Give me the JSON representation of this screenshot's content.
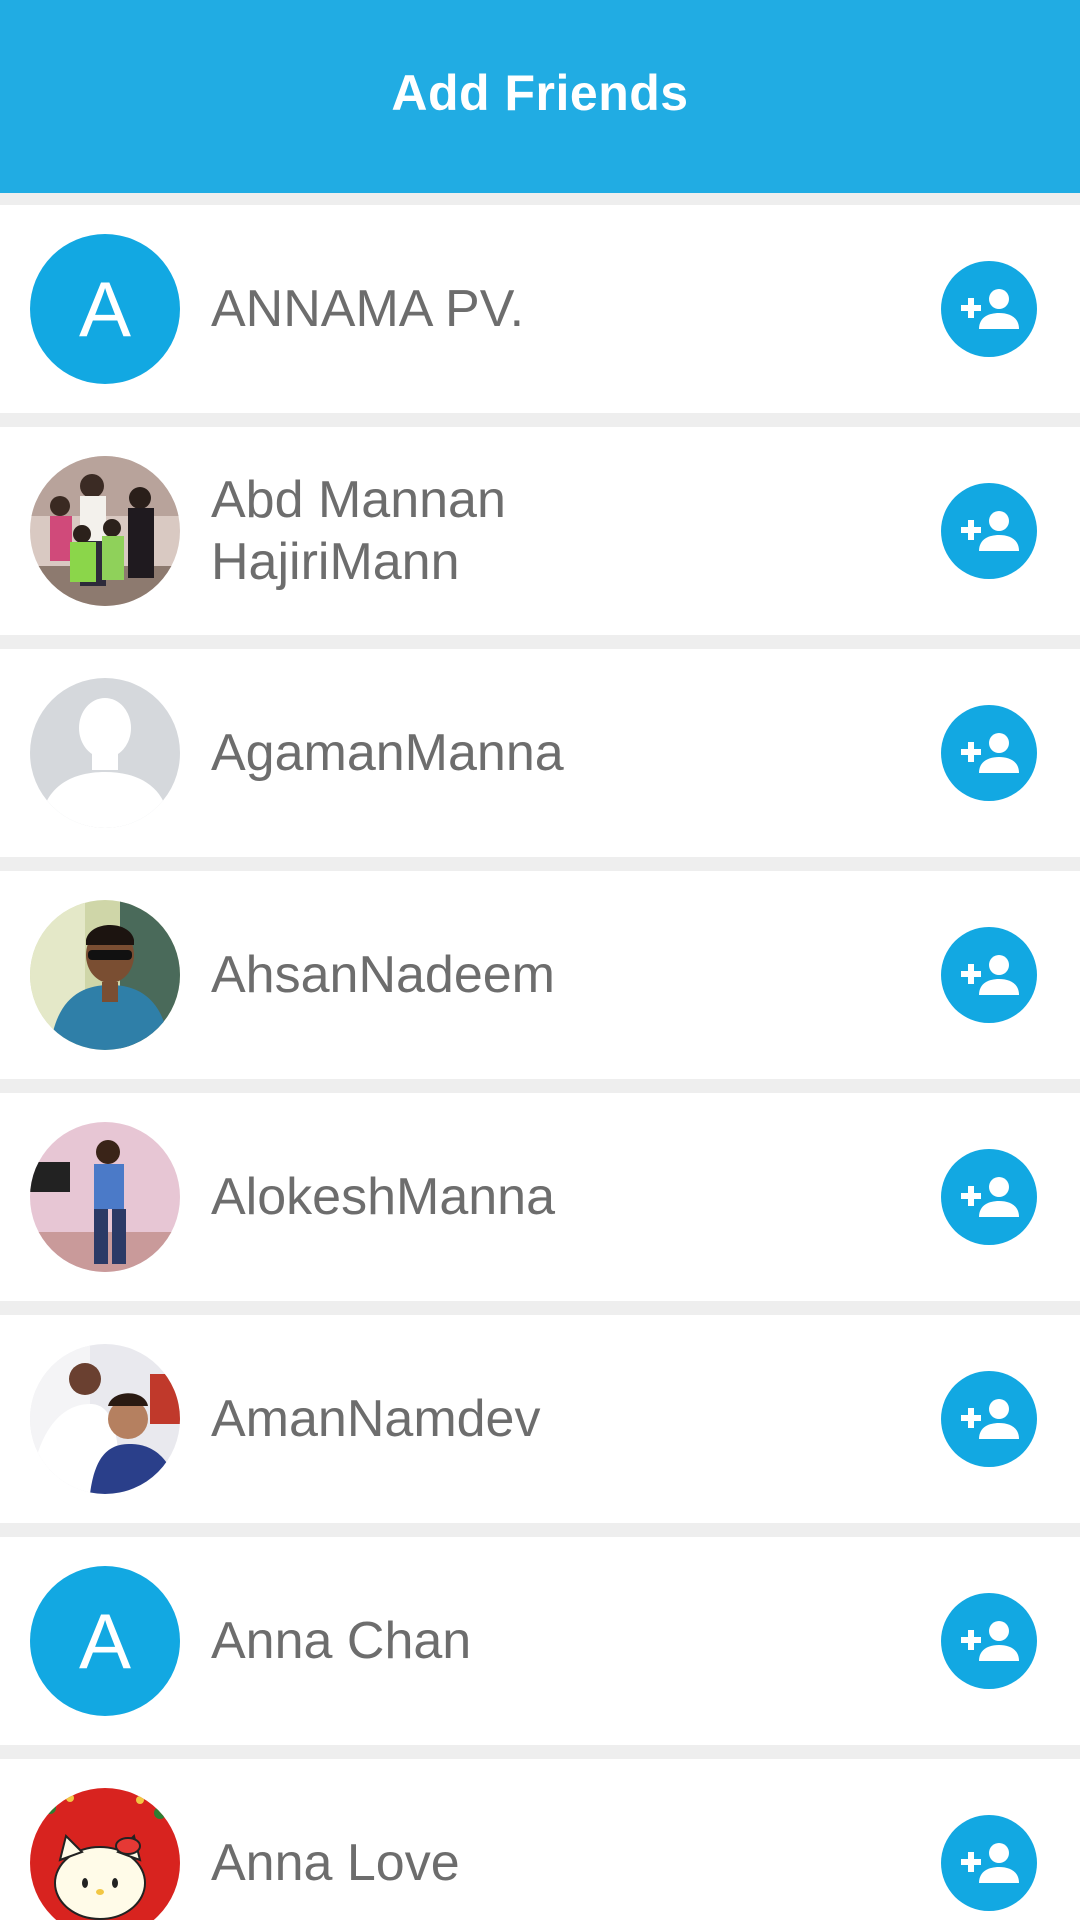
{
  "header": {
    "title": "Add Friends",
    "color": "#21ace3"
  },
  "friends": [
    {
      "name_lines": [
        "ANNAMA PV."
      ],
      "avatar": {
        "type": "letter",
        "letter": "A"
      },
      "action_icon": "add-friend-icon"
    },
    {
      "name_lines": [
        "Abd Mannan",
        "HajiriMann"
      ],
      "avatar": {
        "type": "photo",
        "icon": "group-photo"
      },
      "action_icon": "add-friend-icon"
    },
    {
      "name_lines": [
        "AgamanManna"
      ],
      "avatar": {
        "type": "placeholder",
        "icon": "default-person-silhouette"
      },
      "action_icon": "add-friend-icon"
    },
    {
      "name_lines": [
        "AhsanNadeem"
      ],
      "avatar": {
        "type": "photo",
        "icon": "person-with-sunglasses-photo"
      },
      "action_icon": "add-friend-icon"
    },
    {
      "name_lines": [
        "AlokeshManna"
      ],
      "avatar": {
        "type": "photo",
        "icon": "person-standing-photo"
      },
      "action_icon": "add-friend-icon"
    },
    {
      "name_lines": [
        "AmanNamdev"
      ],
      "avatar": {
        "type": "photo",
        "icon": "selfie-photo"
      },
      "action_icon": "add-friend-icon"
    },
    {
      "name_lines": [
        "Anna Chan"
      ],
      "avatar": {
        "type": "letter",
        "letter": "A"
      },
      "action_icon": "add-friend-icon"
    },
    {
      "name_lines": [
        "Anna Love"
      ],
      "avatar": {
        "type": "photo",
        "icon": "hello-kitty-photo"
      },
      "action_icon": "add-friend-icon"
    }
  ],
  "colors": {
    "accent": "#12a8e2",
    "name_text": "#6d6d6d",
    "divider": "#eeeeee"
  }
}
